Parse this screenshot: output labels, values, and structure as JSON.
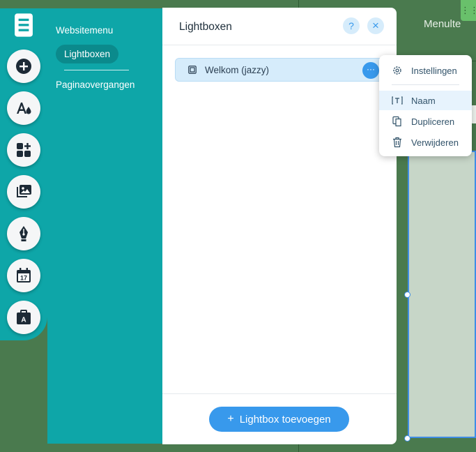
{
  "canvas": {
    "menu_label": "Menulte"
  },
  "toolbar": {
    "items": [
      {
        "name": "pages",
        "icon": "pages-icon"
      },
      {
        "name": "add",
        "icon": "plus-icon"
      },
      {
        "name": "design",
        "icon": "theme-icon"
      },
      {
        "name": "apps",
        "icon": "apps-icon"
      },
      {
        "name": "media",
        "icon": "media-icon"
      },
      {
        "name": "blog",
        "icon": "pen-icon"
      },
      {
        "name": "bookings",
        "icon": "calendar-icon"
      },
      {
        "name": "business",
        "icon": "briefcase-icon"
      }
    ],
    "calendar_day": "17",
    "briefcase_letter": "A"
  },
  "nav": {
    "items": [
      {
        "label": "Websitemenu"
      },
      {
        "label": "Lightboxen"
      },
      {
        "label": "Paginaovergangen"
      }
    ],
    "active_index": 1
  },
  "panel": {
    "title": "Lightboxen",
    "help": "?",
    "close": "×",
    "lightboxes": [
      {
        "label": "Welkom (jazzy)"
      }
    ],
    "add_button": {
      "plus": "+",
      "label": "Lightbox toevoegen"
    }
  },
  "context_menu": {
    "items": [
      {
        "label": "Instellingen",
        "icon": "gear-icon"
      },
      {
        "label": "Naam",
        "icon": "rename-icon"
      },
      {
        "label": "Dupliceren",
        "icon": "duplicate-icon"
      },
      {
        "label": "Verwijderen",
        "icon": "trash-icon"
      }
    ],
    "highlighted_index": 1
  },
  "colors": {
    "teal": "#0ea6a8",
    "teal_active": "#0b8a8c",
    "accent_blue": "#3899ec",
    "row_highlight": "#d6ecfb",
    "canvas_green": "#4a7a4e"
  }
}
